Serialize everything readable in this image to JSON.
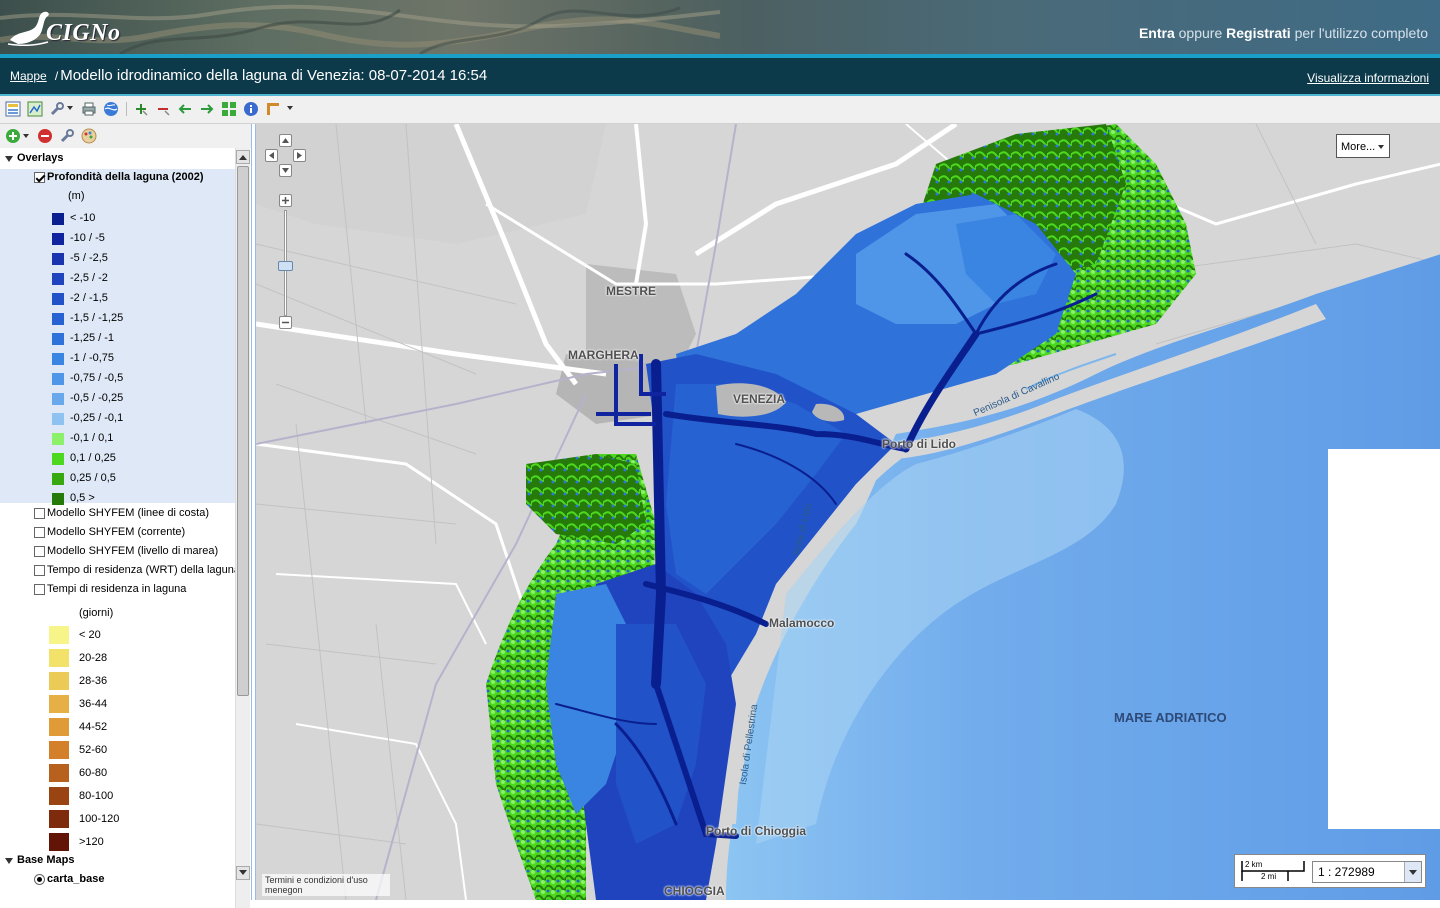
{
  "header": {
    "logo_text": "CIGNo",
    "login_entra": "Entra",
    "login_oppure": "oppure",
    "login_registrati": "Registrati",
    "login_tail": "per l'utilizzo completo"
  },
  "titlebar": {
    "breadcrumb_link": "Mappe",
    "breadcrumb_sep": "/",
    "title": "Modello idrodinamico della laguna di Venezia: 08-07-2014 16:54",
    "info_link": "Visualizza informazioni"
  },
  "toolbar": {
    "icons": [
      "layers-icon",
      "new-map-icon",
      "tools-icon",
      "print-icon",
      "globe-icon",
      "zoom-in-icon",
      "zoom-out-icon",
      "back-icon",
      "forward-icon",
      "zoom-extent-icon",
      "info-icon",
      "measure-icon"
    ]
  },
  "layer_tree": {
    "toolbar_icons": [
      "add-layer-icon",
      "remove-layer-icon",
      "layer-properties-icon",
      "layer-style-icon"
    ],
    "overlays_label": "Overlays",
    "depth_layer": {
      "label": "Profondità della laguna (2002)",
      "checked": true,
      "unit": "(m)",
      "classes": [
        {
          "label": "< -10",
          "color": "#0a1f8f"
        },
        {
          "label": "-10 / -5",
          "color": "#1024a0"
        },
        {
          "label": "-5 / -2,5",
          "color": "#1a34b0"
        },
        {
          "label": "-2,5 / -2",
          "color": "#1f44be"
        },
        {
          "label": "-2 / -1,5",
          "color": "#2152c8"
        },
        {
          "label": "-1,5 / -1,25",
          "color": "#2662d2"
        },
        {
          "label": "-1,25 / -1",
          "color": "#2e72da"
        },
        {
          "label": "-1 / -0,75",
          "color": "#3a84e2"
        },
        {
          "label": "-0,75 / -0,5",
          "color": "#4f96e8"
        },
        {
          "label": "-0,5 / -0,25",
          "color": "#6aa8ec"
        },
        {
          "label": "-0,25 / -0,1",
          "color": "#8ec2f0"
        },
        {
          "label": "-0,1 / 0,1",
          "color": "#8cf06a"
        },
        {
          "label": "0,1 / 0,25",
          "color": "#4cd81e"
        },
        {
          "label": "0,25 / 0,5",
          "color": "#37a80f"
        },
        {
          "label": "0,5 >",
          "color": "#267a0a"
        }
      ]
    },
    "other_layers": [
      {
        "label": "Modello SHYFEM (linee di costa)",
        "checked": false
      },
      {
        "label": "Modello SHYFEM (corrente)",
        "checked": false
      },
      {
        "label": "Modello SHYFEM (livello di marea)",
        "checked": false
      },
      {
        "label": "Tempo di residenza (WRT) della laguna",
        "checked": false
      },
      {
        "label": "Tempi di residenza in laguna",
        "checked": false
      }
    ],
    "residence_legend": {
      "unit": "(giorni)",
      "classes": [
        {
          "label": "< 20",
          "color": "#f7f58a"
        },
        {
          "label": "20-28",
          "color": "#f2e26a"
        },
        {
          "label": "28-36",
          "color": "#ecca56"
        },
        {
          "label": "36-44",
          "color": "#e6b046"
        },
        {
          "label": "44-52",
          "color": "#e09a38"
        },
        {
          "label": "52-60",
          "color": "#d4802a"
        },
        {
          "label": "60-80",
          "color": "#b8601e"
        },
        {
          "label": "80-100",
          "color": "#9a4414"
        },
        {
          "label": "100-120",
          "color": "#7e2a0c"
        },
        {
          "label": ">120",
          "color": "#621406"
        }
      ]
    },
    "basemaps_label": "Base Maps",
    "basemap_selected": "carta_base"
  },
  "map": {
    "labels": {
      "mestre": "MESTRE",
      "marghera": "MARGHERA",
      "venezia": "VENEZIA",
      "porto_lido": "Porto di Lido",
      "malamocco": "Malamocco",
      "chioggia_porto": "Porto di Chioggia",
      "chioggia": "CHIOGGIA",
      "penisola": "Penisola di Cavallino",
      "isola_lido": "Isola di Lido",
      "pellestrina": "Isola di Pellestrina",
      "mare": "MARE ADRIATICO"
    },
    "more_button": "More...",
    "attribution_terms": "Termini e condizioni d'uso",
    "attribution_provider": "menegon",
    "scale_km": "2 km",
    "scale_mi": "2 mi",
    "scale_value": "1 : 272989",
    "colors": {
      "land": "#d6d6d6",
      "urban": "#b7b7b7",
      "sea_near": "#7fb7ec",
      "sea_far": "#5f9ce6",
      "lagoon_deep": "#1c3ca8"
    }
  }
}
